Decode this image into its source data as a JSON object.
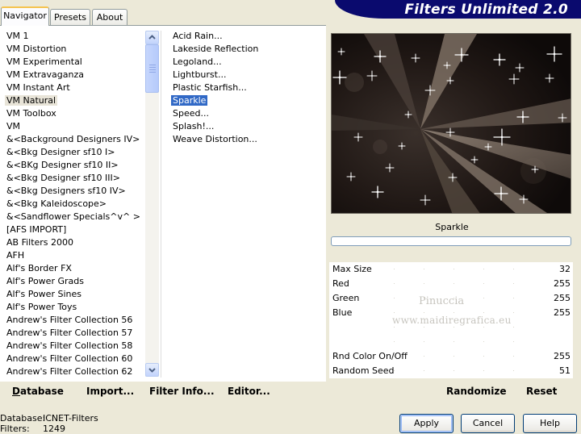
{
  "banner": {
    "title": "Filters Unlimited 2.0"
  },
  "tabs": [
    {
      "label": "Navigator",
      "active": true
    },
    {
      "label": "Presets",
      "active": false
    },
    {
      "label": "About",
      "active": false
    }
  ],
  "categories": [
    "VM 1",
    "VM Distortion",
    "VM Experimental",
    "VM Extravaganza",
    "VM Instant Art",
    "VM Natural",
    "VM Toolbox",
    "VM",
    "&<Background Designers IV>",
    "&<Bkg Designer sf10 I>",
    "&<BKg Designer sf10 II>",
    "&<Bkg Designer sf10 III>",
    "&<Bkg Designers sf10 IV>",
    "&<Bkg Kaleidoscope>",
    "&<Sandflower Specials^v^ >",
    "[AFS IMPORT]",
    "AB Filters 2000",
    "AFH",
    "Alf's Border FX",
    "Alf's Power Grads",
    "Alf's Power Sines",
    "Alf's Power Toys",
    "Andrew's Filter Collection 56",
    "Andrew's Filter Collection 57",
    "Andrew's Filter Collection 58",
    "Andrew's Filter Collection 60",
    "Andrew's Filter Collection 62"
  ],
  "selected_category": "VM Natural",
  "filters": [
    "Acid Rain...",
    "Lakeside Reflection",
    "Legoland...",
    "Lightburst...",
    "Plastic Starfish...",
    "Sparkle",
    "Speed...",
    "Splash!...",
    "Weave Distortion..."
  ],
  "selected_filter": "Sparkle",
  "preview": {
    "filter_name": "Sparkle",
    "progress": 0
  },
  "watermark": {
    "line1": "Pinuccia",
    "line2": "www.maidiregrafica.eu"
  },
  "params": [
    {
      "label": "Max Size",
      "value": "32"
    },
    {
      "label": "Red",
      "value": "255"
    },
    {
      "label": "Green",
      "value": "255"
    },
    {
      "label": "Blue",
      "value": "255"
    },
    {
      "label": "",
      "value": ""
    },
    {
      "label": "",
      "value": ""
    },
    {
      "label": "Rnd Color On/Off",
      "value": "255"
    },
    {
      "label": "Random Seed",
      "value": "51"
    }
  ],
  "toolbar": {
    "database_label": "Database",
    "import_label": "Import...",
    "filter_info_label": "Filter Info...",
    "editor_label": "Editor...",
    "randomize_label": "Randomize",
    "reset_label": "Reset"
  },
  "status": {
    "database_key": "Database:",
    "database_value": "ICNET-Filters",
    "filters_key": "Filters:",
    "filters_value": "1249"
  },
  "dialog_buttons": {
    "apply": "Apply",
    "cancel": "Cancel",
    "help": "Help"
  },
  "colors": {
    "banner": "#0A0A6E",
    "selection": "#3169C6",
    "window": "#ECE9D8"
  }
}
